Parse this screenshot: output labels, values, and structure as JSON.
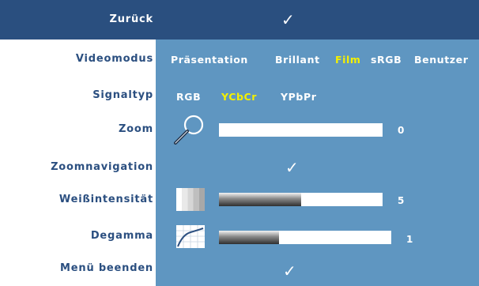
{
  "menu": {
    "back": {
      "label": "Zurück"
    },
    "video_mode": {
      "label": "Videomodus",
      "options": [
        "Präsentation",
        "Brillant",
        "Film",
        "sRGB",
        "Benutzer"
      ],
      "selected": "Film"
    },
    "signal_type": {
      "label": "Signaltyp",
      "options": [
        "RGB",
        "YCbCr",
        "YPbPr"
      ],
      "selected": "YCbCr"
    },
    "zoom": {
      "label": "Zoom",
      "value": "0",
      "icon": "magnifier-icon"
    },
    "zoom_navigation": {
      "label": "Zoomnavigation"
    },
    "white_intensity": {
      "label": "Weißintensität",
      "value": "5",
      "icon": "white-intensity-icon"
    },
    "degamma": {
      "label": "Degamma",
      "value": "1",
      "icon": "degamma-curve-icon"
    },
    "exit_menu": {
      "label": "Menü beenden"
    }
  },
  "colors": {
    "selection_bar": "#2a4f7f",
    "panel": "#5f96c1",
    "label_text": "#2b4f80",
    "active_option": "#f4f000"
  },
  "levels": {
    "zoom_fill_fraction": 0.0,
    "white_intensity_fill_fraction": 0.5,
    "degamma_fill_fraction": 0.35
  }
}
